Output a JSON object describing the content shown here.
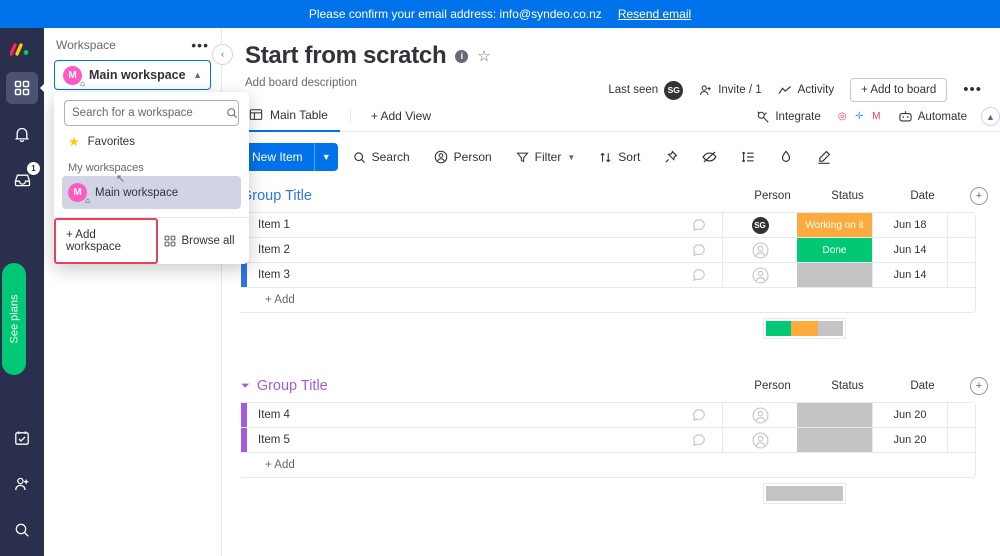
{
  "banner": {
    "message": "Please confirm your email address: info@syndeo.co.nz",
    "link_label": "Resend email",
    "bg": "#0073ea"
  },
  "rail": {
    "logo": "monday-logo",
    "items": [
      {
        "name": "home-grid",
        "icon": "grid-icon",
        "active": true
      },
      {
        "name": "notifications",
        "icon": "bell-icon",
        "active": false
      },
      {
        "name": "inbox",
        "icon": "inbox-icon",
        "active": false,
        "badge": "1"
      }
    ],
    "see_plans_label": "See plans",
    "bottom_items": [
      {
        "name": "my-work",
        "icon": "calendar-check-icon"
      },
      {
        "name": "invite-members",
        "icon": "person-add-icon"
      },
      {
        "name": "search",
        "icon": "search-icon"
      }
    ]
  },
  "workspace_panel": {
    "header_label": "Workspace",
    "menu_icon": "ellipsis-icon",
    "collapse_icon": "chevron-left-icon",
    "selected": {
      "initial": "M",
      "label": "Main workspace",
      "avatar_color": "#ff5ac4",
      "chevron": "chevron-up-icon"
    }
  },
  "workspace_dropdown": {
    "search_placeholder": "Search for a workspace",
    "search_value": "",
    "search_icon": "search-icon",
    "favorites_label": "Favorites",
    "favorites_icon": "star-icon",
    "section_label": "My workspaces",
    "items": [
      {
        "initial": "M",
        "label": "Main workspace",
        "avatar_color": "#ff5ac4",
        "selected": true
      }
    ],
    "add_workspace_label": "+ Add workspace",
    "browse_all_label": "Browse all",
    "browse_all_icon": "grid-icon",
    "highlight_color": "#e2445c"
  },
  "board": {
    "title": "Start from scratch",
    "info_icon": "info-icon",
    "star_icon": "star-outline-icon",
    "description_placeholder": "Add board description",
    "header_actions": {
      "last_seen_label": "Last seen",
      "last_seen_avatar": "SG",
      "invite_label": "Invite / 1",
      "invite_icon": "person-add-icon",
      "activity_label": "Activity",
      "activity_icon": "activity-graph-icon",
      "add_to_board_label": "+ Add to board",
      "more_icon": "ellipsis-icon"
    },
    "tabs": [
      {
        "label": "Main Table",
        "icon": "table-icon",
        "active": true
      }
    ],
    "add_view_label": "+ Add View",
    "integrate_label": "Integrate",
    "integrate_icon": "integrate-icon",
    "integration_apps": [
      {
        "name": "app-pink-hex",
        "glyph": "◎",
        "color": "#e2445c"
      },
      {
        "name": "app-blue-hex",
        "glyph": "✛",
        "color": "#579bfc"
      },
      {
        "name": "gmail-hex",
        "glyph": "M",
        "color": "#e2445c"
      }
    ],
    "automate_label": "Automate",
    "automate_icon": "robot-icon",
    "collapse_header_icon": "chevron-up-icon"
  },
  "toolbar": {
    "new_item_label": "New Item",
    "new_item_caret": "chevron-down-icon",
    "items": [
      {
        "label": "Search",
        "icon": "search-icon",
        "caret": false
      },
      {
        "label": "Person",
        "icon": "person-circle-icon",
        "caret": false
      },
      {
        "label": "Filter",
        "icon": "funnel-icon",
        "caret": true
      },
      {
        "label": "Sort",
        "icon": "sort-icon",
        "caret": false
      }
    ],
    "icon_only": [
      {
        "name": "pin-icon"
      },
      {
        "name": "hide-eye-icon"
      },
      {
        "name": "row-height-icon"
      },
      {
        "name": "color-drop-icon"
      },
      {
        "name": "pen-icon"
      }
    ]
  },
  "table": {
    "columns": [
      "Person",
      "Status",
      "Date"
    ],
    "add_column_icon": "plus-circle-icon",
    "add_row_label": "+ Add",
    "chat_icon": "comment-icon",
    "person_placeholder_icon": "person-circle-icon",
    "groups": [
      {
        "title": "Group Title",
        "color": "#2b76e5",
        "arrow_icon": "chevron-down-icon",
        "rows": [
          {
            "name": "Item 1",
            "person": "SG",
            "person_type": "avatar",
            "status": "Working on it",
            "status_color": "#fdab3d",
            "date": "Jun 18"
          },
          {
            "name": "Item 2",
            "person": "",
            "person_type": "empty",
            "status": "Done",
            "status_color": "#00c875",
            "date": "Jun 14"
          },
          {
            "name": "Item 3",
            "person": "",
            "person_type": "empty",
            "status": "",
            "status_color": "#c4c4c4",
            "date": "Jun 14"
          }
        ],
        "summary": [
          {
            "color": "#00c875",
            "pct": 33
          },
          {
            "color": "#fdab3d",
            "pct": 34
          },
          {
            "color": "#c4c4c4",
            "pct": 33
          }
        ]
      },
      {
        "title": "Group Title",
        "color": "#a25ddc",
        "arrow_icon": "chevron-down-icon",
        "rows": [
          {
            "name": "Item 4",
            "person": "",
            "person_type": "empty",
            "status": "",
            "status_color": "#c4c4c4",
            "date": "Jun 20"
          },
          {
            "name": "Item 5",
            "person": "",
            "person_type": "empty",
            "status": "",
            "status_color": "#c4c4c4",
            "date": "Jun 20"
          }
        ],
        "summary": [
          {
            "color": "#c4c4c4",
            "pct": 100
          }
        ]
      }
    ]
  }
}
